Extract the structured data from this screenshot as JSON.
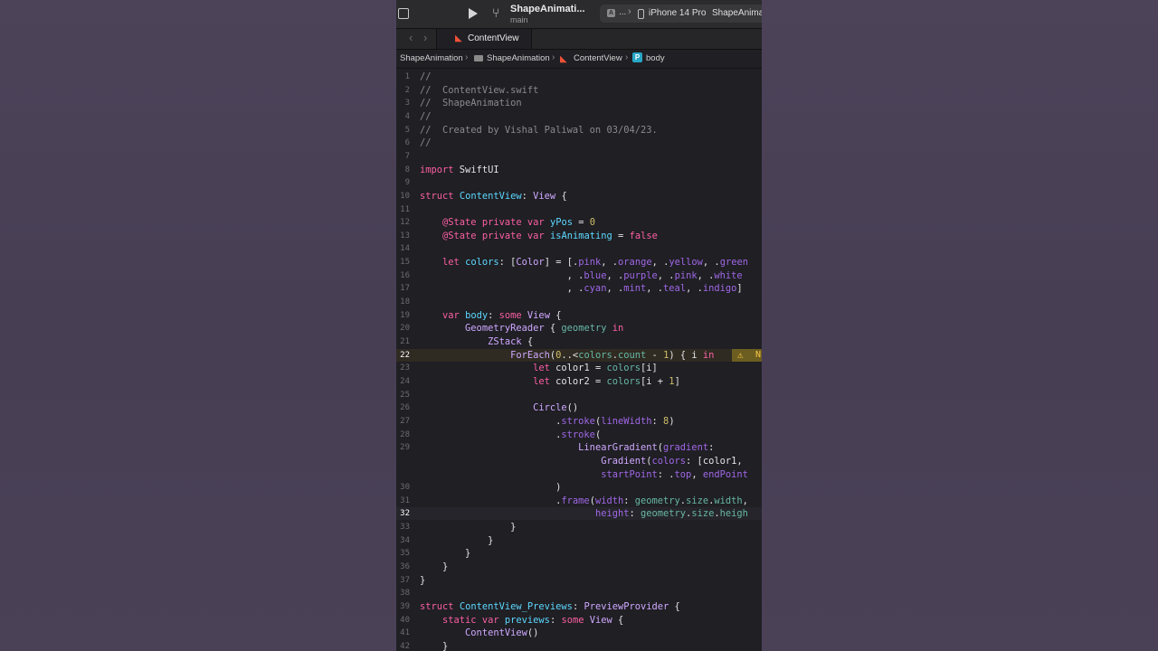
{
  "toolbar": {
    "project_name": "ShapeAnimati...",
    "branch": "main",
    "scheme_ellipsis": "...",
    "device": "iPhone 14 Pro",
    "run_status": "ShapeAnimat"
  },
  "tab": {
    "label": "ContentView"
  },
  "jumpbar": {
    "project": "ShapeAnimation",
    "folder": "ShapeAnimation",
    "file": "ContentView",
    "symbol": "body",
    "symbol_badge": "P"
  },
  "warning": {
    "text": "N"
  },
  "colors": {
    "comment": "#8a8a8e",
    "keyword": "#fc5fa3",
    "type": "#d0a8ff",
    "func": "#a167e6",
    "number": "#d0bf69",
    "plain": "#e4e4e4",
    "decl": "#5dd8ff",
    "member": "#67b7a4",
    "string": "#fc6a5d"
  },
  "editor": {
    "lines": [
      {
        "n": "1",
        "segs": [
          [
            "//",
            "comment"
          ]
        ]
      },
      {
        "n": "2",
        "segs": [
          [
            "//  ContentView.swift",
            "comment"
          ]
        ]
      },
      {
        "n": "3",
        "segs": [
          [
            "//  ShapeAnimation",
            "comment"
          ]
        ]
      },
      {
        "n": "4",
        "segs": [
          [
            "//",
            "comment"
          ]
        ]
      },
      {
        "n": "5",
        "segs": [
          [
            "//  Created by Vishal Paliwal on 03/04/23.",
            "comment"
          ]
        ]
      },
      {
        "n": "6",
        "segs": [
          [
            "//",
            "comment"
          ]
        ]
      },
      {
        "n": "7",
        "segs": []
      },
      {
        "n": "8",
        "segs": [
          [
            "import",
            "keyword"
          ],
          [
            " SwiftUI",
            "plain"
          ]
        ]
      },
      {
        "n": "9",
        "segs": []
      },
      {
        "n": "10",
        "segs": [
          [
            "struct",
            "keyword"
          ],
          [
            " ",
            "plain"
          ],
          [
            "ContentView",
            "decl"
          ],
          [
            ": ",
            "plain"
          ],
          [
            "View",
            "type"
          ],
          [
            " {",
            "plain"
          ]
        ]
      },
      {
        "n": "11",
        "segs": []
      },
      {
        "n": "12",
        "segs": [
          [
            "    ",
            "plain"
          ],
          [
            "@State",
            "keyword"
          ],
          [
            " ",
            "plain"
          ],
          [
            "private",
            "keyword"
          ],
          [
            " ",
            "plain"
          ],
          [
            "var",
            "keyword"
          ],
          [
            " ",
            "plain"
          ],
          [
            "yPos",
            "decl"
          ],
          [
            " = ",
            "plain"
          ],
          [
            "0",
            "number"
          ]
        ]
      },
      {
        "n": "13",
        "segs": [
          [
            "    ",
            "plain"
          ],
          [
            "@State",
            "keyword"
          ],
          [
            " ",
            "plain"
          ],
          [
            "private",
            "keyword"
          ],
          [
            " ",
            "plain"
          ],
          [
            "var",
            "keyword"
          ],
          [
            " ",
            "plain"
          ],
          [
            "isAnimating",
            "decl"
          ],
          [
            " = ",
            "plain"
          ],
          [
            "false",
            "keyword"
          ]
        ]
      },
      {
        "n": "14",
        "segs": []
      },
      {
        "n": "15",
        "segs": [
          [
            "    ",
            "plain"
          ],
          [
            "let",
            "keyword"
          ],
          [
            " ",
            "plain"
          ],
          [
            "colors",
            "decl"
          ],
          [
            ": [",
            "plain"
          ],
          [
            "Color",
            "type"
          ],
          [
            "] = [.",
            "plain"
          ],
          [
            "pink",
            "func"
          ],
          [
            ", .",
            "plain"
          ],
          [
            "orange",
            "func"
          ],
          [
            ", .",
            "plain"
          ],
          [
            "yellow",
            "func"
          ],
          [
            ", .",
            "plain"
          ],
          [
            "green",
            "func"
          ]
        ]
      },
      {
        "n": "16",
        "segs": [
          [
            "                          , .",
            "plain"
          ],
          [
            "blue",
            "func"
          ],
          [
            ", .",
            "plain"
          ],
          [
            "purple",
            "func"
          ],
          [
            ", .",
            "plain"
          ],
          [
            "pink",
            "func"
          ],
          [
            ", .",
            "plain"
          ],
          [
            "white",
            "func"
          ]
        ]
      },
      {
        "n": "17",
        "segs": [
          [
            "                          , .",
            "plain"
          ],
          [
            "cyan",
            "func"
          ],
          [
            ", .",
            "plain"
          ],
          [
            "mint",
            "func"
          ],
          [
            ", .",
            "plain"
          ],
          [
            "teal",
            "func"
          ],
          [
            ", .",
            "plain"
          ],
          [
            "indigo",
            "func"
          ],
          [
            "]",
            "plain"
          ]
        ]
      },
      {
        "n": "18",
        "segs": []
      },
      {
        "n": "19",
        "segs": [
          [
            "    ",
            "plain"
          ],
          [
            "var",
            "keyword"
          ],
          [
            " ",
            "plain"
          ],
          [
            "body",
            "decl"
          ],
          [
            ": ",
            "plain"
          ],
          [
            "some",
            "keyword"
          ],
          [
            " ",
            "plain"
          ],
          [
            "View",
            "type"
          ],
          [
            " {",
            "plain"
          ]
        ]
      },
      {
        "n": "20",
        "segs": [
          [
            "        ",
            "plain"
          ],
          [
            "GeometryReader",
            "type"
          ],
          [
            " { ",
            "plain"
          ],
          [
            "geometry",
            "member"
          ],
          [
            " ",
            "plain"
          ],
          [
            "in",
            "keyword"
          ]
        ]
      },
      {
        "n": "21",
        "segs": [
          [
            "            ",
            "plain"
          ],
          [
            "ZStack",
            "type"
          ],
          [
            " {",
            "plain"
          ]
        ]
      },
      {
        "n": "22",
        "hl": true,
        "segs": [
          [
            "                ",
            "plain"
          ],
          [
            "ForEach",
            "type"
          ],
          [
            "(",
            "plain"
          ],
          [
            "0",
            "number"
          ],
          [
            "..<",
            "plain"
          ],
          [
            "colors",
            "member"
          ],
          [
            ".",
            "plain"
          ],
          [
            "count",
            "member"
          ],
          [
            " - ",
            "plain"
          ],
          [
            "1",
            "number"
          ],
          [
            ") { i ",
            "plain"
          ],
          [
            "in",
            "keyword"
          ]
        ]
      },
      {
        "n": "23",
        "segs": [
          [
            "                    ",
            "plain"
          ],
          [
            "let",
            "keyword"
          ],
          [
            " color1 = ",
            "plain"
          ],
          [
            "colors",
            "member"
          ],
          [
            "[i]",
            "plain"
          ]
        ]
      },
      {
        "n": "24",
        "segs": [
          [
            "                    ",
            "plain"
          ],
          [
            "let",
            "keyword"
          ],
          [
            " color2 = ",
            "plain"
          ],
          [
            "colors",
            "member"
          ],
          [
            "[i + ",
            "plain"
          ],
          [
            "1",
            "number"
          ],
          [
            "]",
            "plain"
          ]
        ]
      },
      {
        "n": "25",
        "segs": []
      },
      {
        "n": "26",
        "segs": [
          [
            "                    ",
            "plain"
          ],
          [
            "Circle",
            "type"
          ],
          [
            "()",
            "plain"
          ]
        ]
      },
      {
        "n": "27",
        "segs": [
          [
            "                        .",
            "plain"
          ],
          [
            "stroke",
            "func"
          ],
          [
            "(",
            "plain"
          ],
          [
            "lineWidth",
            "func"
          ],
          [
            ": ",
            "plain"
          ],
          [
            "8",
            "number"
          ],
          [
            ")",
            "plain"
          ]
        ]
      },
      {
        "n": "28",
        "segs": [
          [
            "                        .",
            "plain"
          ],
          [
            "stroke",
            "func"
          ],
          [
            "(",
            "plain"
          ]
        ]
      },
      {
        "n": "29",
        "segs": [
          [
            "                            ",
            "plain"
          ],
          [
            "LinearGradient",
            "type"
          ],
          [
            "(",
            "plain"
          ],
          [
            "gradient",
            "func"
          ],
          [
            ":",
            "plain"
          ]
        ]
      },
      {
        "n": "",
        "segs": [
          [
            "                                ",
            "plain"
          ],
          [
            "Gradient",
            "type"
          ],
          [
            "(",
            "plain"
          ],
          [
            "colors",
            "func"
          ],
          [
            ": [color1,",
            "plain"
          ]
        ]
      },
      {
        "n": "",
        "segs": [
          [
            "                                ",
            "plain"
          ],
          [
            "startPoint",
            "func"
          ],
          [
            ": .",
            "plain"
          ],
          [
            "top",
            "func"
          ],
          [
            ", ",
            "plain"
          ],
          [
            "endPoint",
            "func"
          ]
        ]
      },
      {
        "n": "30",
        "segs": [
          [
            "                        )",
            "plain"
          ]
        ]
      },
      {
        "n": "31",
        "segs": [
          [
            "                        .",
            "plain"
          ],
          [
            "frame",
            "func"
          ],
          [
            "(",
            "plain"
          ],
          [
            "width",
            "func"
          ],
          [
            ": ",
            "plain"
          ],
          [
            "geometry",
            "member"
          ],
          [
            ".",
            "plain"
          ],
          [
            "size",
            "member"
          ],
          [
            ".",
            "plain"
          ],
          [
            "width",
            "member"
          ],
          [
            ",",
            "plain"
          ]
        ]
      },
      {
        "n": "32",
        "cur": true,
        "segs": [
          [
            "                               ",
            "plain"
          ],
          [
            "height",
            "func"
          ],
          [
            ": ",
            "plain"
          ],
          [
            "geometry",
            "member"
          ],
          [
            ".",
            "plain"
          ],
          [
            "size",
            "member"
          ],
          [
            ".",
            "plain"
          ],
          [
            "heigh",
            "member"
          ]
        ]
      },
      {
        "n": "33",
        "segs": [
          [
            "                }",
            "plain"
          ]
        ]
      },
      {
        "n": "34",
        "segs": [
          [
            "            }",
            "plain"
          ]
        ]
      },
      {
        "n": "35",
        "segs": [
          [
            "        }",
            "plain"
          ]
        ]
      },
      {
        "n": "36",
        "segs": [
          [
            "    }",
            "plain"
          ]
        ]
      },
      {
        "n": "37",
        "segs": [
          [
            "}",
            "plain"
          ]
        ]
      },
      {
        "n": "38",
        "segs": []
      },
      {
        "n": "39",
        "segs": [
          [
            "struct",
            "keyword"
          ],
          [
            " ",
            "plain"
          ],
          [
            "ContentView_Previews",
            "decl"
          ],
          [
            ": ",
            "plain"
          ],
          [
            "PreviewProvider",
            "type"
          ],
          [
            " {",
            "plain"
          ]
        ]
      },
      {
        "n": "40",
        "segs": [
          [
            "    ",
            "plain"
          ],
          [
            "static",
            "keyword"
          ],
          [
            " ",
            "plain"
          ],
          [
            "var",
            "keyword"
          ],
          [
            " ",
            "plain"
          ],
          [
            "previews",
            "decl"
          ],
          [
            ": ",
            "plain"
          ],
          [
            "some",
            "keyword"
          ],
          [
            " ",
            "plain"
          ],
          [
            "View",
            "type"
          ],
          [
            " {",
            "plain"
          ]
        ]
      },
      {
        "n": "41",
        "segs": [
          [
            "        ",
            "plain"
          ],
          [
            "ContentView",
            "type"
          ],
          [
            "()",
            "plain"
          ]
        ]
      },
      {
        "n": "42",
        "segs": [
          [
            "    }",
            "plain"
          ]
        ]
      }
    ]
  }
}
